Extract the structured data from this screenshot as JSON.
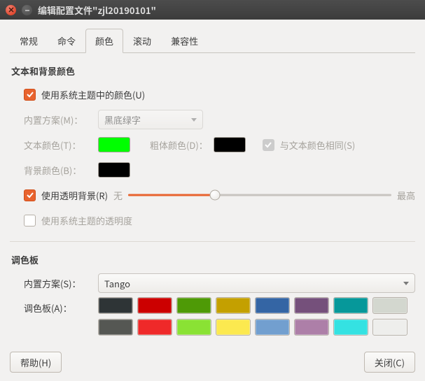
{
  "window": {
    "title": "编辑配置文件\"zjl20190101\""
  },
  "tabs": [
    "常规",
    "命令",
    "颜色",
    "滚动",
    "兼容性"
  ],
  "active_tab_index": 2,
  "section_text": {
    "title": "文本和背景颜色"
  },
  "use_system_theme": {
    "label": "使用系统主题中的颜色(U)",
    "checked": true
  },
  "builtin_scheme": {
    "label": "内置方案(M)：",
    "value": "黑底绿字"
  },
  "text_color": {
    "label": "文本颜色(T)：",
    "value": "#00ff00"
  },
  "bold_color": {
    "label": "粗体颜色(D)：",
    "value": "#000000"
  },
  "same_as_text": {
    "label": "与文本颜色相同(S)",
    "checked": true
  },
  "bg_color": {
    "label": "背景颜色(B)：",
    "value": "#000000"
  },
  "use_transparent": {
    "label": "使用透明背景(R)",
    "checked": true
  },
  "slider": {
    "min_label": "无",
    "max_label": "最高",
    "percent": 33
  },
  "use_system_transparency": {
    "label": "使用系统主题的透明度",
    "checked": false
  },
  "palette_section": {
    "title": "调色板"
  },
  "palette_builtin": {
    "label": "内置方案(S)：",
    "value": "Tango"
  },
  "palette_label": "调色板(A)：",
  "palette_rows": [
    [
      "#2e3436",
      "#cc0000",
      "#4e9a06",
      "#c4a000",
      "#3465a4",
      "#75507b",
      "#06989a",
      "#d3d7cf"
    ],
    [
      "#555753",
      "#ef2929",
      "#8ae234",
      "#fce94f",
      "#729fcf",
      "#ad7fa8",
      "#34e2e2",
      "#eeeeec"
    ]
  ],
  "footer": {
    "help": "帮助(H)",
    "close": "关闭(C)"
  }
}
